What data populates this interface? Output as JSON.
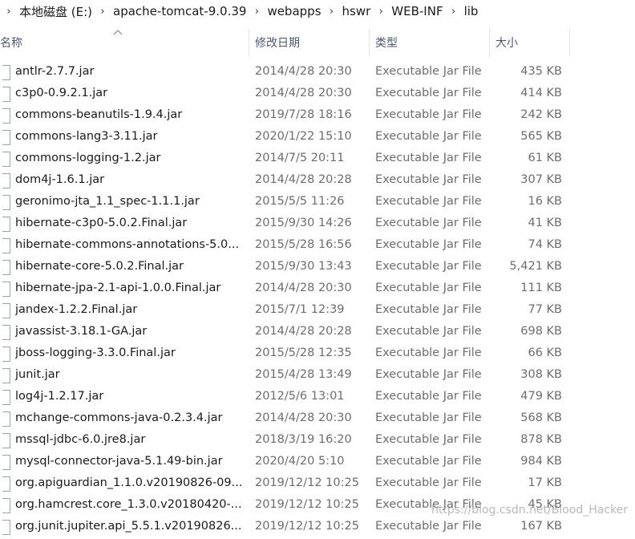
{
  "breadcrumb": {
    "items": [
      "本地磁盘 (E:)",
      "apache-tomcat-9.0.39",
      "webapps",
      "hswr",
      "WEB-INF",
      "lib"
    ],
    "separator": "›"
  },
  "columns": {
    "name": "名称",
    "date": "修改日期",
    "type": "类型",
    "size": "大小"
  },
  "files": [
    {
      "name": "antlr-2.7.7.jar",
      "date": "2014/4/28 20:30",
      "type": "Executable Jar File",
      "size": "435 KB"
    },
    {
      "name": "c3p0-0.9.2.1.jar",
      "date": "2014/4/28 20:30",
      "type": "Executable Jar File",
      "size": "414 KB"
    },
    {
      "name": "commons-beanutils-1.9.4.jar",
      "date": "2019/7/28 18:16",
      "type": "Executable Jar File",
      "size": "242 KB"
    },
    {
      "name": "commons-lang3-3.11.jar",
      "date": "2020/1/22 15:10",
      "type": "Executable Jar File",
      "size": "565 KB"
    },
    {
      "name": "commons-logging-1.2.jar",
      "date": "2014/7/5 20:11",
      "type": "Executable Jar File",
      "size": "61 KB"
    },
    {
      "name": "dom4j-1.6.1.jar",
      "date": "2014/4/28 20:28",
      "type": "Executable Jar File",
      "size": "307 KB"
    },
    {
      "name": "geronimo-jta_1.1_spec-1.1.1.jar",
      "date": "2015/5/5 11:26",
      "type": "Executable Jar File",
      "size": "16 KB"
    },
    {
      "name": "hibernate-c3p0-5.0.2.Final.jar",
      "date": "2015/9/30 14:26",
      "type": "Executable Jar File",
      "size": "41 KB"
    },
    {
      "name": "hibernate-commons-annotations-5.0...",
      "date": "2015/5/28 16:56",
      "type": "Executable Jar File",
      "size": "74 KB"
    },
    {
      "name": "hibernate-core-5.0.2.Final.jar",
      "date": "2015/9/30 13:43",
      "type": "Executable Jar File",
      "size": "5,421 KB"
    },
    {
      "name": "hibernate-jpa-2.1-api-1.0.0.Final.jar",
      "date": "2014/4/28 20:30",
      "type": "Executable Jar File",
      "size": "111 KB"
    },
    {
      "name": "jandex-1.2.2.Final.jar",
      "date": "2015/7/1 12:39",
      "type": "Executable Jar File",
      "size": "77 KB"
    },
    {
      "name": "javassist-3.18.1-GA.jar",
      "date": "2014/4/28 20:28",
      "type": "Executable Jar File",
      "size": "698 KB"
    },
    {
      "name": "jboss-logging-3.3.0.Final.jar",
      "date": "2015/5/28 12:35",
      "type": "Executable Jar File",
      "size": "66 KB"
    },
    {
      "name": "junit.jar",
      "date": "2015/4/28 13:49",
      "type": "Executable Jar File",
      "size": "308 KB"
    },
    {
      "name": "log4j-1.2.17.jar",
      "date": "2012/5/6 13:01",
      "type": "Executable Jar File",
      "size": "479 KB"
    },
    {
      "name": "mchange-commons-java-0.2.3.4.jar",
      "date": "2014/4/28 20:30",
      "type": "Executable Jar File",
      "size": "568 KB"
    },
    {
      "name": "mssql-jdbc-6.0.jre8.jar",
      "date": "2018/3/19 16:20",
      "type": "Executable Jar File",
      "size": "878 KB"
    },
    {
      "name": "mysql-connector-java-5.1.49-bin.jar",
      "date": "2020/4/20 5:10",
      "type": "Executable Jar File",
      "size": "984 KB"
    },
    {
      "name": "org.apiguardian_1.1.0.v20190826-09...",
      "date": "2019/12/12 10:25",
      "type": "Executable Jar File",
      "size": "17 KB"
    },
    {
      "name": "org.hamcrest.core_1.3.0.v20180420-...",
      "date": "2019/12/12 10:25",
      "type": "Executable Jar File",
      "size": "45 KB"
    },
    {
      "name": "org.junit.jupiter.api_5.5.1.v20190826...",
      "date": "2019/12/12 10:25",
      "type": "Executable Jar File",
      "size": "167 KB"
    }
  ],
  "watermark": "https://blog.csdn.net/Blood_Hacker",
  "icons": {
    "file": "file-icon",
    "sort": "sort-up-icon"
  },
  "colors": {
    "text": "#1a1a1a",
    "muted": "#6d6d6d",
    "header": "#4a5970"
  }
}
